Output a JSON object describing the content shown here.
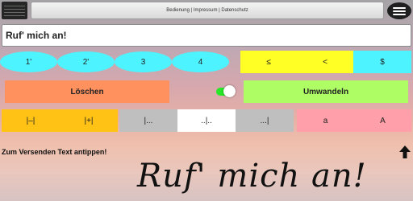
{
  "header": {
    "links_text": "Bedienung | Impressum | Datenschutz"
  },
  "input": {
    "value": "Ruf' mich an!"
  },
  "row_apostrophes": {
    "ovals": [
      "1'",
      "2'",
      "3",
      "4"
    ],
    "yellow": [
      "≤",
      "<"
    ],
    "dollar": "$"
  },
  "actions": {
    "delete_label": "Löschen",
    "convert_label": "Umwandeln",
    "toggle_on": true
  },
  "separators": {
    "orange": [
      "|–|",
      "|+|"
    ],
    "grey": [
      "|...",
      "..|..",
      "...|"
    ],
    "case": [
      "a",
      "A"
    ]
  },
  "hint": "Zum Versenden Text antippen!",
  "output_script": "Ruf' mich an!",
  "colors": {
    "cyan": "#4df3ff",
    "yellow": "#ffff25",
    "orange": "#ffc215",
    "salmon": "#ff915f",
    "green": "#aefd65",
    "grey": "#bfbfbf",
    "pink": "#ff9fa9"
  }
}
